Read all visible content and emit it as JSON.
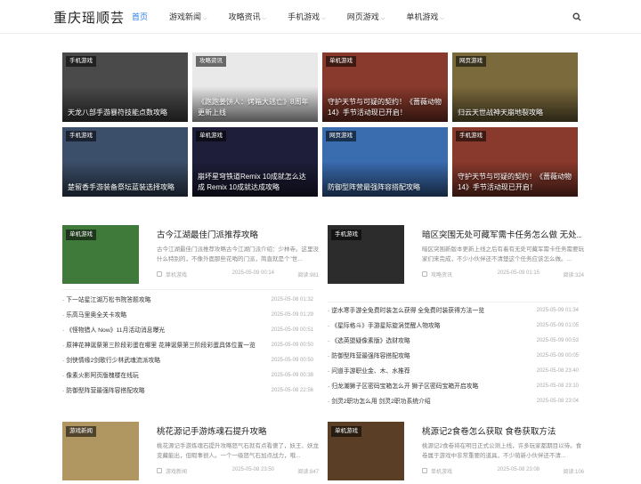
{
  "site": {
    "title": "重庆瑶顺芸"
  },
  "nav": [
    {
      "label": "首页",
      "active": true,
      "dropdown": false
    },
    {
      "label": "游戏新闻",
      "active": false,
      "dropdown": true
    },
    {
      "label": "攻略资讯",
      "active": false,
      "dropdown": true
    },
    {
      "label": "手机游戏",
      "active": false,
      "dropdown": true
    },
    {
      "label": "网页游戏",
      "active": false,
      "dropdown": true
    },
    {
      "label": "单机游戏",
      "active": false,
      "dropdown": true
    }
  ],
  "grid": [
    {
      "tag": "手机游戏",
      "title": "天龙八部手游暴符技能点数攻略",
      "bg": "#4a4a4a"
    },
    {
      "tag": "攻略资讯",
      "title": "《跑跑姜饼人：烤箱大逃亡》8周年更新上线",
      "bg": "#e9e9e9"
    },
    {
      "tag": "单机游戏",
      "title": "守护天节与可疑的契约！《蔷薇动物14》手节活动现已开启！",
      "bg": "#8a3a2c"
    },
    {
      "tag": "网页游戏",
      "title": "归云天世战神天崩地裂攻略",
      "bg": "#7a6a3c"
    },
    {
      "tag": "手机游戏",
      "title": "楚留香手游装备祭坛蓝装选择攻略",
      "bg": "#3c4f6a"
    },
    {
      "tag": "单机游戏",
      "title": "崩坏星穹铁道Remix 10成就怎么达成 Remix 10成就达成攻略",
      "bg": "#1e1e3a"
    },
    {
      "tag": "网页游戏",
      "title": "防御型阵营最强阵容搭配攻略",
      "bg": "#3a6cb0"
    },
    {
      "tag": "手机游戏",
      "title": "守护天节与可疑的契约！《蔷薇动物14》手节活动现已开启！",
      "bg": "#8a3a2c"
    }
  ],
  "featured": [
    {
      "tag": "单机游戏",
      "title": "古今江湖最佳门派推荐攻略",
      "desc": "古今江湖最佳门派推荐攻略古今江湖门派介绍：少林寺。这里没什么特别的，不像外面那些花哨的门派，简直就是个\"世...",
      "category": "单机游戏",
      "date": "2025-05-09 00:14",
      "views": "阅读:981",
      "bg": "#3f7a3a"
    },
    {
      "tag": "手机游戏",
      "title": "暗区突围无处可藏军需卡任务怎么做 无处...",
      "desc": "暗区突围新版本更新上线之后有着有无处可藏军需卡任务需要玩家们来完成，不少小伙伴还不清楚这个任务应该怎么做。...",
      "category": "攻略资讯",
      "date": "2025-05-09 01:15",
      "views": "阅读:324",
      "bg": "#2c2c2c"
    },
    {
      "tag": "游戏新闻",
      "title": "桃花源记手游炼魂石提升攻略",
      "desc": "桃花源记手游炼魂石提升攻略怒气石就有点看傻了，妖王、妖龙变藏能出，但暇事很人。一个一级怒气石加点战力，哦...",
      "category": "游戏新闻",
      "date": "2025-05-08 23:50",
      "views": "阅读:847",
      "bg": "#b09660"
    },
    {
      "tag": "单机游戏",
      "title": "桃源记2食卷怎么获取 食卷获取方法",
      "desc": "桃源记2食卷将在明日正式公测上线，许多玩家都期目以待。食卷属于游戏中非常重要的道具，不少萌新小伙伴还不清...",
      "category": "单机游戏",
      "date": "2025-05-08 23:08",
      "views": "阅读:106",
      "bg": "#5a3e26"
    }
  ],
  "list_left": [
    {
      "title": "下一站星江湖万松书院答题攻略",
      "date": "2025-05-08 01:32"
    },
    {
      "title": "乐高马里奥全关卡攻略",
      "date": "2025-05-09 01:29"
    },
    {
      "title": "《怪物猎人 Now》11月活动消息曝光",
      "date": "2025-05-09 00:51"
    },
    {
      "title": "原神花神诞祭第三阶段彩蛋在哪里 花神诞祭第三阶段彩蛋具体位置一览",
      "date": "2025-05-09 00:50"
    },
    {
      "title": "剑侠情缘2剑歌行少林武魂流派攻略",
      "date": "2025-05-09 00:50"
    },
    {
      "title": "像素火影阿页版槐楼在线玩",
      "date": "2025-05-09 00:38"
    },
    {
      "title": "防御型阵营最强阵容搭配攻略",
      "date": "2025-05-08 22:56"
    }
  ],
  "list_right": [
    {
      "title": "逆水寒手游全免费时装怎么获得 全免费时装获得方法一览",
      "date": "2025-05-09 01:34"
    },
    {
      "title": "《星际格斗》手游星际旋涡觉醒人物攻略",
      "date": "2025-05-09 01:05"
    },
    {
      "title": "《选英盟疑像素版》选财攻略",
      "date": "2025-05-09 00:53"
    },
    {
      "title": "防御型阵营最强阵容搭配攻略",
      "date": "2025-05-09 00:05"
    },
    {
      "title": "问道手游职业金、木、水推荐",
      "date": "2025-05-08 23:40"
    },
    {
      "title": "归龙潮狮子区密码宝箱怎么开 狮子区密码宝箱开启攻略",
      "date": "2025-05-08 23:10"
    },
    {
      "title": "剑灵2职功怎么用 剑灵2职功系统介绍",
      "date": "2025-05-08 23:04"
    }
  ]
}
